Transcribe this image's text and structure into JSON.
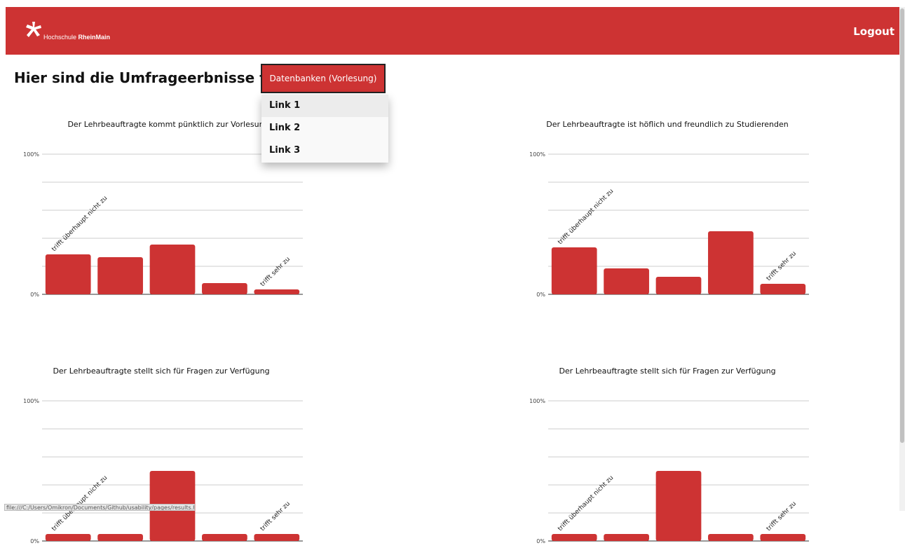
{
  "header": {
    "logo_text_light": "Hochschule ",
    "logo_text_bold": "RheinMain",
    "logout_label": "Logout",
    "brand_color": "#cd3333"
  },
  "page": {
    "heading": "Hier sind die Umfrageerbnisse für:",
    "selected_course": "Datenbanken (Vorlesung)"
  },
  "dropdown": {
    "items": [
      "Link 1",
      "Link 2",
      "Link 3"
    ]
  },
  "status_bar": {
    "url": "file:///C:/Users/Omikron/Documents/Github/usability/pages/results.html#"
  },
  "chart_data": [
    {
      "type": "bar",
      "title": "Der Lehrbeauftragte kommt pünktlich zur Vorlesung",
      "categories": [
        "trifft überhaupt nicht zu",
        "",
        "",
        "",
        "trifft sehr zu"
      ],
      "values": [
        28.5,
        26.5,
        35.5,
        8,
        3.5
      ],
      "ylim": [
        0,
        100
      ],
      "yticks": [
        "0%",
        "100%"
      ],
      "grid": true,
      "color": "#cd3333"
    },
    {
      "type": "bar",
      "title": "Der Lehrbeauftragte ist höflich und freundlich zu Studierenden",
      "categories": [
        "trifft überhaupt nicht zu",
        "",
        "",
        "",
        "trifft sehr zu"
      ],
      "values": [
        33.5,
        18.5,
        12.5,
        45,
        7.5
      ],
      "ylim": [
        0,
        100
      ],
      "yticks": [
        "0%",
        "100%"
      ],
      "grid": true,
      "color": "#cd3333"
    },
    {
      "type": "bar",
      "title": "Der Lehrbeauftragte stellt sich für Fragen zur Verfügung",
      "categories": [
        "trifft überhaupt nicht zu",
        "",
        "",
        "",
        "trifft sehr zu"
      ],
      "values": [
        5,
        5,
        50,
        5,
        5
      ],
      "ylim": [
        0,
        100
      ],
      "yticks": [
        "0%",
        "100%"
      ],
      "grid": true,
      "color": "#cd3333"
    },
    {
      "type": "bar",
      "title": "Der Lehrbeauftragte stellt sich für Fragen zur Verfügung",
      "categories": [
        "trifft überhaupt nicht zu",
        "",
        "",
        "",
        "trifft sehr zu"
      ],
      "values": [
        5,
        5,
        50,
        5,
        5
      ],
      "ylim": [
        0,
        100
      ],
      "yticks": [
        "0%",
        "100%"
      ],
      "grid": true,
      "color": "#cd3333"
    }
  ]
}
